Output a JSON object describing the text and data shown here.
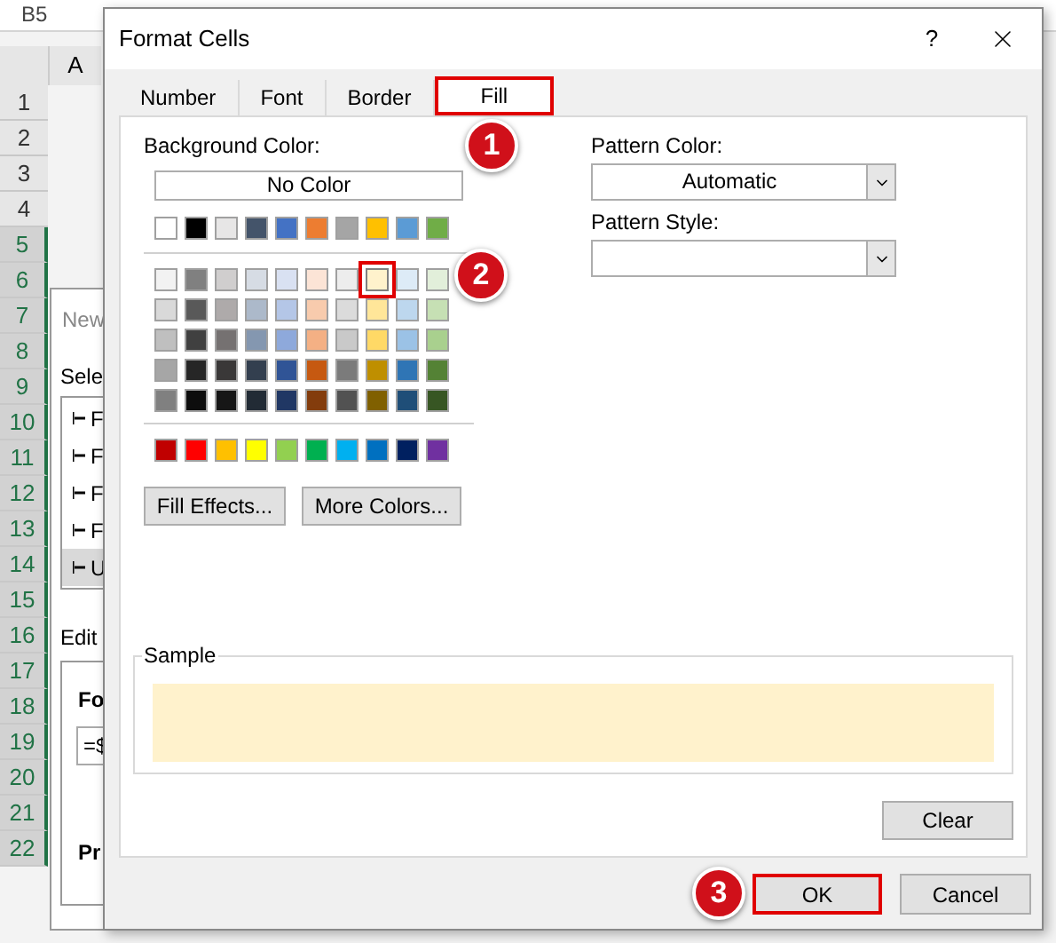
{
  "spreadsheet": {
    "name_box": "B5",
    "column_header": "A",
    "rows": [
      {
        "label": "1",
        "selected": false
      },
      {
        "label": "2",
        "selected": false
      },
      {
        "label": "3",
        "selected": false
      },
      {
        "label": "4",
        "selected": false
      },
      {
        "label": "5",
        "selected": true
      },
      {
        "label": "6",
        "selected": true
      },
      {
        "label": "7",
        "selected": true
      },
      {
        "label": "8",
        "selected": true
      },
      {
        "label": "9",
        "selected": true
      },
      {
        "label": "10",
        "selected": true
      },
      {
        "label": "11",
        "selected": true
      },
      {
        "label": "12",
        "selected": true
      },
      {
        "label": "13",
        "selected": true
      },
      {
        "label": "14",
        "selected": true
      },
      {
        "label": "15",
        "selected": true
      },
      {
        "label": "16",
        "selected": true
      },
      {
        "label": "17",
        "selected": true
      },
      {
        "label": "18",
        "selected": true
      },
      {
        "label": "19",
        "selected": true
      },
      {
        "label": "20",
        "selected": true
      },
      {
        "label": "21",
        "selected": true
      },
      {
        "label": "22",
        "selected": true
      }
    ]
  },
  "back_dialog": {
    "title": "New",
    "select_label": "Sele",
    "rule_items": [
      {
        "label": "F",
        "selected": false
      },
      {
        "label": "F",
        "selected": false
      },
      {
        "label": "F",
        "selected": false
      },
      {
        "label": "F",
        "selected": false
      },
      {
        "label": "U",
        "selected": true
      }
    ],
    "edit_label": "Edit",
    "format_label": "Fo",
    "formula": "=$",
    "preview_label": "Pr"
  },
  "dialog": {
    "title": "Format Cells",
    "help": "?",
    "tabs": [
      {
        "label": "Number",
        "selected": false,
        "highlighted": false
      },
      {
        "label": "Font",
        "selected": false,
        "highlighted": false
      },
      {
        "label": "Border",
        "selected": false,
        "highlighted": false
      },
      {
        "label": "Fill",
        "selected": true,
        "highlighted": true
      }
    ],
    "background_color_label": "Background Color:",
    "no_color_button": "No Color",
    "theme_colors": [
      {
        "color": "#ffffff",
        "selected": false
      },
      {
        "color": "#000000",
        "selected": false
      },
      {
        "color": "#e7e6e6",
        "selected": false
      },
      {
        "color": "#44546a",
        "selected": false
      },
      {
        "color": "#4472c4",
        "selected": false
      },
      {
        "color": "#ed7d31",
        "selected": false
      },
      {
        "color": "#a5a5a5",
        "selected": false
      },
      {
        "color": "#ffc000",
        "selected": false
      },
      {
        "color": "#5b9bd5",
        "selected": false
      },
      {
        "color": "#70ad47",
        "selected": false
      }
    ],
    "tint_rows": [
      [
        {
          "color": "#f2f2f2",
          "selected": false
        },
        {
          "color": "#808080",
          "selected": false
        },
        {
          "color": "#d0cece",
          "selected": false
        },
        {
          "color": "#d6dce4",
          "selected": false
        },
        {
          "color": "#d9e1f2",
          "selected": false
        },
        {
          "color": "#fce4d6",
          "selected": false
        },
        {
          "color": "#ededed",
          "selected": false
        },
        {
          "color": "#fff2cc",
          "selected": true
        },
        {
          "color": "#ddebf7",
          "selected": false
        },
        {
          "color": "#e2efda",
          "selected": false
        }
      ],
      [
        {
          "color": "#d9d9d9",
          "selected": false
        },
        {
          "color": "#595959",
          "selected": false
        },
        {
          "color": "#aeaaaa",
          "selected": false
        },
        {
          "color": "#acb9ca",
          "selected": false
        },
        {
          "color": "#b4c6e7",
          "selected": false
        },
        {
          "color": "#f8cbad",
          "selected": false
        },
        {
          "color": "#dbdbdb",
          "selected": false
        },
        {
          "color": "#ffe699",
          "selected": false
        },
        {
          "color": "#bdd7ee",
          "selected": false
        },
        {
          "color": "#c6e0b4",
          "selected": false
        }
      ],
      [
        {
          "color": "#bfbfbf",
          "selected": false
        },
        {
          "color": "#404040",
          "selected": false
        },
        {
          "color": "#757171",
          "selected": false
        },
        {
          "color": "#8497b0",
          "selected": false
        },
        {
          "color": "#8ea9db",
          "selected": false
        },
        {
          "color": "#f4b084",
          "selected": false
        },
        {
          "color": "#c9c9c9",
          "selected": false
        },
        {
          "color": "#ffd966",
          "selected": false
        },
        {
          "color": "#9bc2e6",
          "selected": false
        },
        {
          "color": "#a9d08e",
          "selected": false
        }
      ],
      [
        {
          "color": "#a6a6a6",
          "selected": false
        },
        {
          "color": "#262626",
          "selected": false
        },
        {
          "color": "#3a3838",
          "selected": false
        },
        {
          "color": "#333f4f",
          "selected": false
        },
        {
          "color": "#305496",
          "selected": false
        },
        {
          "color": "#c65911",
          "selected": false
        },
        {
          "color": "#7b7b7b",
          "selected": false
        },
        {
          "color": "#bf8f00",
          "selected": false
        },
        {
          "color": "#2f75b5",
          "selected": false
        },
        {
          "color": "#548235",
          "selected": false
        }
      ],
      [
        {
          "color": "#808080",
          "selected": false
        },
        {
          "color": "#0d0d0d",
          "selected": false
        },
        {
          "color": "#161616",
          "selected": false
        },
        {
          "color": "#222b35",
          "selected": false
        },
        {
          "color": "#203764",
          "selected": false
        },
        {
          "color": "#833c0c",
          "selected": false
        },
        {
          "color": "#525252",
          "selected": false
        },
        {
          "color": "#806000",
          "selected": false
        },
        {
          "color": "#1f4e78",
          "selected": false
        },
        {
          "color": "#375623",
          "selected": false
        }
      ]
    ],
    "standard_colors": [
      {
        "color": "#c00000",
        "selected": false
      },
      {
        "color": "#ff0000",
        "selected": false
      },
      {
        "color": "#ffc000",
        "selected": false
      },
      {
        "color": "#ffff00",
        "selected": false
      },
      {
        "color": "#92d050",
        "selected": false
      },
      {
        "color": "#00b050",
        "selected": false
      },
      {
        "color": "#00b0f0",
        "selected": false
      },
      {
        "color": "#0070c0",
        "selected": false
      },
      {
        "color": "#002060",
        "selected": false
      },
      {
        "color": "#7030a0",
        "selected": false
      }
    ],
    "fill_effects_button": "Fill Effects...",
    "more_colors_button": "More Colors...",
    "pattern_color_label": "Pattern Color:",
    "pattern_color_value": "Automatic",
    "pattern_style_label": "Pattern Style:",
    "sample_label": "Sample",
    "clear_button": "Clear",
    "buttons": [
      {
        "label": "OK",
        "highlighted": true
      },
      {
        "label": "Cancel",
        "highlighted": false
      }
    ]
  },
  "steps": [
    "1",
    "2",
    "3"
  ]
}
